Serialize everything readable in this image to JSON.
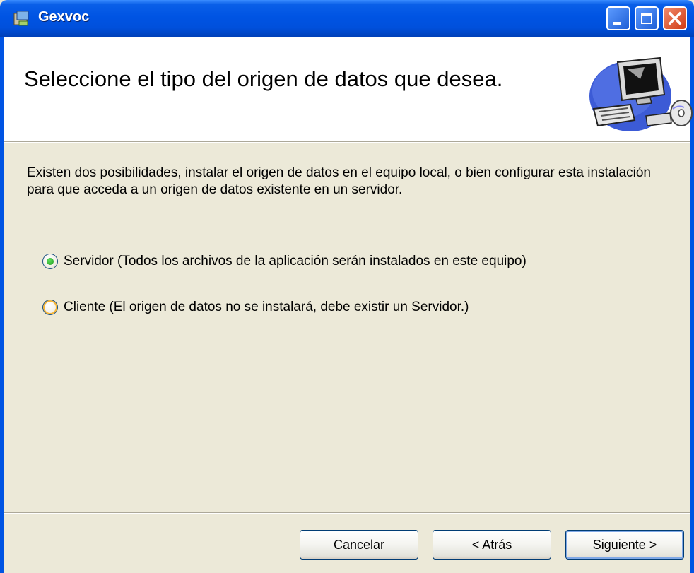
{
  "window": {
    "title": "Gexvoc",
    "controls": [
      "minimize",
      "maximize",
      "close"
    ]
  },
  "banner": {
    "heading": "Seleccione el tipo del origen de datos que desea.",
    "image": "computer-setup-icon"
  },
  "description": "Existen dos posibilidades, instalar el origen de datos en el equipo local, o bien configurar esta instalación para que acceda a un origen de datos existente en un servidor.",
  "options": [
    {
      "label": "Servidor  (Todos los archivos de la aplicación serán instalados en este equipo)",
      "selected": true
    },
    {
      "label": "Cliente  (El origen de datos no se instalará, debe existir un Servidor.)",
      "selected": false
    }
  ],
  "buttons": {
    "cancel": "Cancelar",
    "back": "< Atrás",
    "next": "Siguiente >"
  }
}
